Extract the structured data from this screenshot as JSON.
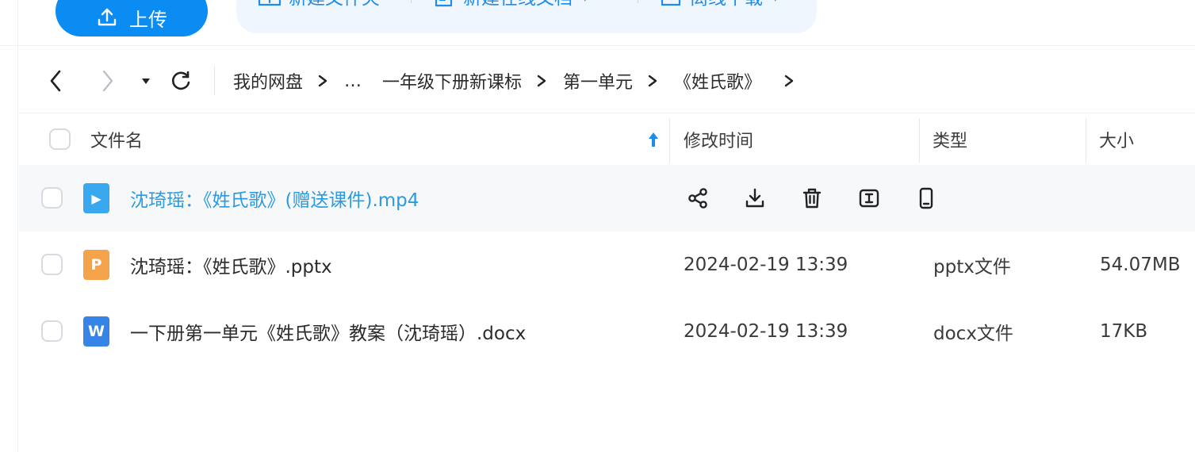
{
  "toolbar": {
    "upload_label": "上传",
    "new_folder_label": "新建文件夹",
    "new_online_doc_label": "新建在线文档",
    "offline_download_label": "离线下载",
    "dropdown_caret": "▼"
  },
  "breadcrumb": {
    "items": [
      "我的网盘",
      "…",
      "一年级下册新课标",
      "第一单元",
      "《姓氏歌》"
    ]
  },
  "table": {
    "columns": {
      "name": "文件名",
      "modified": "修改时间",
      "type": "类型",
      "size": "大小"
    },
    "rows": [
      {
        "name": "沈琦瑶：《姓氏歌》(赠送课件).mp4",
        "modified": "",
        "type": "",
        "size": "",
        "icon": "video-file-icon",
        "icon_letter": "▶"
      },
      {
        "name": "沈琦瑶：《姓氏歌》.pptx",
        "modified": "2024-02-19 13:39",
        "type": "pptx文件",
        "size": "54.07MB",
        "icon": "pptx-file-icon",
        "icon_letter": "P"
      },
      {
        "name": "一下册第一单元《姓氏歌》教案（沈琦瑶）.docx",
        "modified": "2024-02-19 13:39",
        "type": "docx文件",
        "size": "17KB",
        "icon": "docx-file-icon",
        "icon_letter": "W"
      }
    ]
  },
  "colors": {
    "accent": "#0a8cf2",
    "toolbar_text": "#1f8de8",
    "link_hover": "#2a9be0",
    "video_icon": "#3aa8ee",
    "pptx_icon": "#f5a34a",
    "docx_icon": "#3585e6"
  }
}
